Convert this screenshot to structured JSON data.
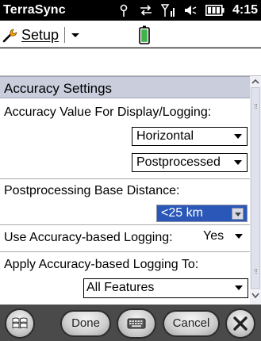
{
  "statusbar": {
    "app_title": "TerraSync",
    "time": "4:15",
    "icons": [
      "antenna-icon",
      "sync-icon",
      "signal-icon",
      "volume-icon",
      "battery-icon"
    ]
  },
  "toolbar": {
    "setup_label": "Setup",
    "setup_icon": "wrench-icon",
    "status_icon": "battery-status-icon"
  },
  "form": {
    "section_title": "Accuracy Settings",
    "accuracy_value_label": "Accuracy Value For Display/Logging:",
    "accuracy_dimension": "Horizontal",
    "accuracy_mode": "Postprocessed",
    "base_distance_label": "Postprocessing Base Distance:",
    "base_distance_value": "<25 km",
    "use_logging_label": "Use Accuracy-based Logging:",
    "use_logging_value": "Yes",
    "apply_logging_label": "Apply Accuracy-based Logging To:",
    "apply_logging_value": "All Features"
  },
  "bottombar": {
    "done_label": "Done",
    "cancel_label": "Cancel"
  },
  "colors": {
    "section_header": "#c9cddc",
    "highlight": "#2a57b8",
    "bottombar": "#4a4a4a"
  }
}
